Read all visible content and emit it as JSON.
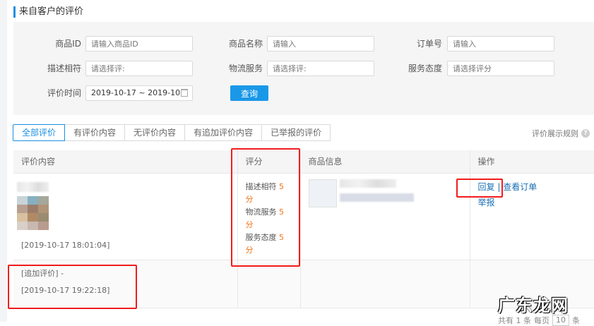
{
  "title": "来自客户的评价",
  "filters": {
    "product_id": {
      "label": "商品ID",
      "placeholder": "请输入商品ID"
    },
    "product_name": {
      "label": "商品名称",
      "placeholder": "请输入"
    },
    "order_no": {
      "label": "订单号",
      "placeholder": "请输入"
    },
    "desc_match": {
      "label": "描述相符",
      "placeholder": "请选择评:"
    },
    "logistics": {
      "label": "物流服务",
      "placeholder": "请选择评:"
    },
    "service": {
      "label": "服务态度",
      "placeholder": "请选择评分"
    },
    "date": {
      "label": "评价时间",
      "value": "2019-10-17 ~ 2019-10"
    },
    "search_label": "查询"
  },
  "tabs": [
    "全部评价",
    "有评价内容",
    "无评价内容",
    "有追加评价内容",
    "已举报的评价"
  ],
  "rules_label": "评价展示规则",
  "rules_icon": "?",
  "table": {
    "headers": [
      "评价内容",
      "评分",
      "商品信息",
      "操作"
    ],
    "row": {
      "date": "[2019-10-17 18:01:04]",
      "scores": [
        {
          "label": "描述相符",
          "value": "5",
          "unit": "分"
        },
        {
          "label": "物流服务",
          "value": "5",
          "unit": "分"
        },
        {
          "label": "服务态度",
          "value": "5",
          "unit": "分"
        }
      ],
      "actions": {
        "reply": "回复",
        "sep": "|",
        "view_order": "查看订单",
        "report": "举报"
      }
    },
    "followup": {
      "label": "[追加评价] -",
      "date": "[2019-10-17 19:22:18]"
    }
  },
  "pagination": {
    "total": "共有 1 条",
    "per_page": "每页",
    "size": "10",
    "unit": "条"
  },
  "watermark": "广东龙网"
}
